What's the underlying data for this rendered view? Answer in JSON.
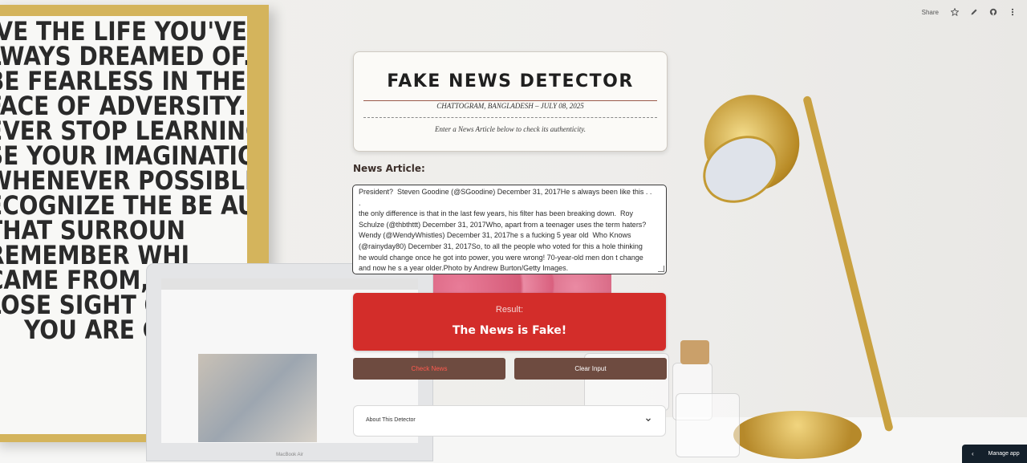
{
  "toolbar": {
    "share_label": "Share",
    "icons": [
      "star-icon",
      "edit-icon",
      "github-icon",
      "more-icon"
    ]
  },
  "header": {
    "title": "FAKE NEWS DETECTOR",
    "dateline": "CHATTOGRAM, BANGLADESH – JULY 08, 2025",
    "tagline": "Enter a News Article below to check its authenticity."
  },
  "article": {
    "label": "News Article:",
    "text": "President?  Steven Goodine (@SGoodine) December 31, 2017He s always been like this . . .\nthe only difference is that in the last few years, his filter has been breaking down.  Roy\nSchulze (@thbthttt) December 31, 2017Who, apart from a teenager uses the term haters?\nWendy (@WendyWhistles) December 31, 2017he s a fucking 5 year old  Who Knows\n(@rainyday80) December 31, 2017So, to all the people who voted for this a hole thinking\nhe would change once he got into power, you were wrong! 70-year-old men don t change\nand now he s a year older.Photo by Andrew Burton/Getty Images."
  },
  "result": {
    "label": "Result:",
    "value": "The News is Fake!",
    "color": "#d32d2a"
  },
  "buttons": {
    "check_label": "Check News",
    "clear_label": "Clear Input"
  },
  "about": {
    "label": "About This Detector"
  },
  "manage_app": {
    "label": "Manage app"
  },
  "laptop": {
    "brand": "MacBook Air"
  },
  "poster": {
    "lines": [
      "IVE THE LIFE YOU'VE",
      "LWAYS  DREAMED OF.",
      "BE FEARLESS IN THE",
      "FACE OF ADVERSITY.",
      "EVER STOP LEARNING.",
      "SE YOUR IMAGINATION",
      "WHENEVER POSSIBLE.",
      "ECOGNIZE THE BE AUTY",
      "THAT SURROUN",
      "REMEMBER WHI",
      "CAME FROM, BU",
      "LOSE SIGHT OF",
      "YOU ARE GO"
    ]
  }
}
